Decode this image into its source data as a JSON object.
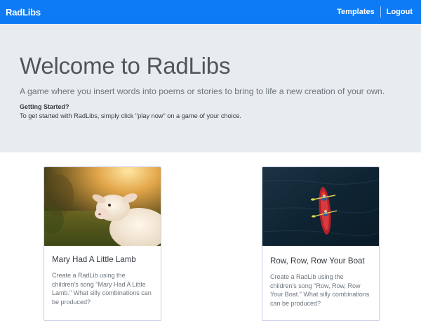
{
  "navbar": {
    "brand": "RadLibs",
    "links": [
      {
        "label": "Templates"
      },
      {
        "label": "Logout"
      }
    ],
    "color": "#0d7bf5"
  },
  "jumbotron": {
    "title": "Welcome to RadLibs",
    "lead": "A game where you insert words into poems or stories to bring to life a new creation of your own.",
    "getting_started_heading": "Getting Started?",
    "getting_started_text": "To get started with RadLibs, simply click \"play now\" on a game of your choice.",
    "background": "#e9ecef"
  },
  "cards": [
    {
      "title": "Mary Had A Little Lamb",
      "text": "Create a RadLib using the children's song \"Mary Had A Little Lamb.\" What silly combinations can be produced?",
      "image": "lamb-photo"
    },
    {
      "title": "Row, Row, Row Your Boat",
      "text": "Create a RadLib using the children's song \"Row, Row, Row Your Boat.\" What silly combinations can be produced?",
      "image": "kayak-photo"
    }
  ]
}
